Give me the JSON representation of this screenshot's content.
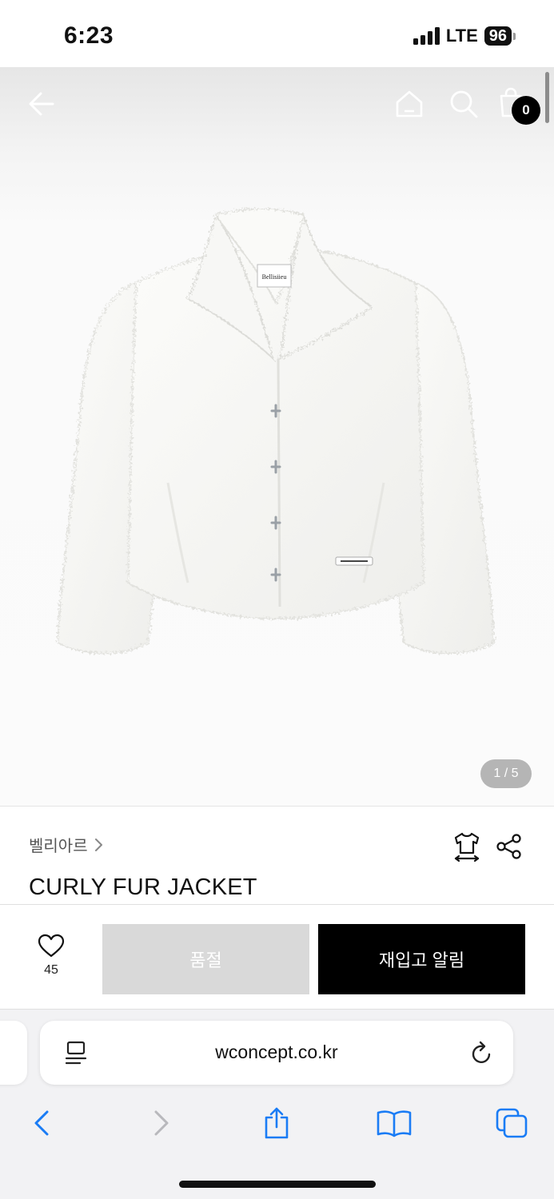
{
  "status_bar": {
    "time": "6:23",
    "network": "LTE",
    "battery": "96"
  },
  "header": {
    "cart_count": "0",
    "icons": [
      "back-arrow-icon",
      "home-icon",
      "search-icon",
      "shopping-bag-icon"
    ]
  },
  "gallery": {
    "page_indicator": "1 / 5",
    "current_page": 1,
    "total_pages": 5,
    "jacket_label": "Bellisiieu"
  },
  "product": {
    "brand": "벨리아르",
    "name": "CURLY FUR JACKET"
  },
  "actions": {
    "like_count": "45",
    "soldout_label": "품절",
    "restock_label": "재입고 알림"
  },
  "browser": {
    "url": "wconcept.co.kr"
  },
  "colors": {
    "primary_button": "#000000",
    "disabled_button": "#d9d9d9",
    "link_blue": "#1a7cf5"
  }
}
